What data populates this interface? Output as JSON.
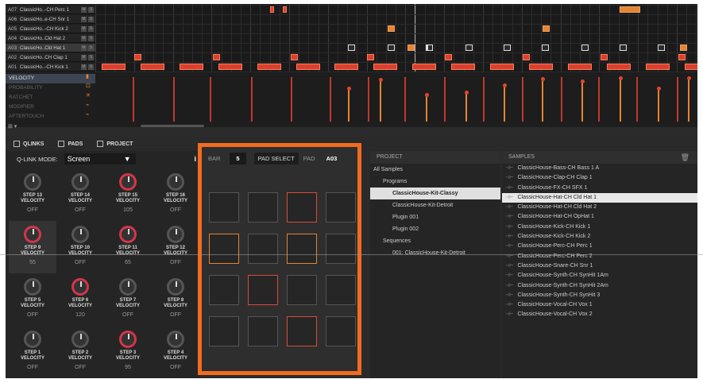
{
  "tracks": [
    {
      "num": "A07",
      "name": "ClassicHo..-CH Perc 1"
    },
    {
      "num": "A06",
      "name": "ClassicHo..e-CH Snr 1"
    },
    {
      "num": "A05",
      "name": "ClassicHo..-CH Kick 2"
    },
    {
      "num": "A04",
      "name": "ClassicHo..Cld Hat 2"
    },
    {
      "num": "A03",
      "name": "ClassicHo..Cld Hat 1"
    },
    {
      "num": "A02",
      "name": "ClassicHo..CH Clap 1"
    },
    {
      "num": "A01",
      "name": "ClassicHo..-CH Kick 1"
    }
  ],
  "track_buttons": {
    "mute": "M",
    "solo": "S"
  },
  "params": [
    "VELOCITY",
    "PROBABILITY",
    "RATCHET",
    "MODIFIER",
    "AFTERTOUCH"
  ],
  "tabs": {
    "qlinks": "QLINKS",
    "pads": "PADS",
    "project": "PROJECT"
  },
  "qlink": {
    "mode_label": "Q-LINK MODE:",
    "mode_value": "Screen",
    "info": "i"
  },
  "knobs": [
    {
      "step": "STEP 13",
      "param": "VELOCITY",
      "value": "OFF",
      "active": false
    },
    {
      "step": "STEP 14",
      "param": "VELOCITY",
      "value": "OFF",
      "active": false
    },
    {
      "step": "STEP 15",
      "param": "VELOCITY",
      "value": "105",
      "active": true
    },
    {
      "step": "STEP 16",
      "param": "VELOCITY",
      "value": "OFF",
      "active": false
    },
    {
      "step": "STEP 9",
      "param": "VELOCITY",
      "value": "55",
      "active": true
    },
    {
      "step": "STEP 10",
      "param": "VELOCITY",
      "value": "OFF",
      "active": false
    },
    {
      "step": "STEP 11",
      "param": "VELOCITY",
      "value": "65",
      "active": true
    },
    {
      "step": "STEP 12",
      "param": "VELOCITY",
      "value": "OFF",
      "active": false
    },
    {
      "step": "STEP 5",
      "param": "VELOCITY",
      "value": "OFF",
      "active": false
    },
    {
      "step": "STEP 6",
      "param": "VELOCITY",
      "value": "120",
      "active": true
    },
    {
      "step": "STEP 7",
      "param": "VELOCITY",
      "value": "OFF",
      "active": false
    },
    {
      "step": "STEP 8",
      "param": "VELOCITY",
      "value": "OFF",
      "active": false
    },
    {
      "step": "STEP 1",
      "param": "VELOCITY",
      "value": "OFF",
      "active": false
    },
    {
      "step": "STEP 2",
      "param": "VELOCITY",
      "value": "OFF",
      "active": false
    },
    {
      "step": "STEP 3",
      "param": "VELOCITY",
      "value": "95",
      "active": true
    },
    {
      "step": "STEP 4",
      "param": "VELOCITY",
      "value": "OFF",
      "active": false
    }
  ],
  "pads": {
    "bar_label": "BAR",
    "bar_value": "5",
    "pad_select": "PAD SELECT",
    "pad_label": "PAD",
    "pad_value": "A03",
    "pad_states": [
      "n",
      "n",
      "r",
      "n",
      "o",
      "n",
      "o",
      "n",
      "n",
      "r",
      "n",
      "n",
      "n",
      "n",
      "r",
      "n"
    ]
  },
  "project": {
    "header": "PROJECT",
    "items": [
      {
        "label": "All Samples",
        "indent": 0,
        "selected": false
      },
      {
        "label": "Programs",
        "indent": 1,
        "selected": false
      },
      {
        "label": "ClassicHouse-Kit-Classy",
        "indent": 2,
        "selected": true
      },
      {
        "label": "ClassicHouse-Kit-Detroit",
        "indent": 2,
        "selected": false
      },
      {
        "label": "Plugin 001",
        "indent": 2,
        "selected": false
      },
      {
        "label": "Plugin 002",
        "indent": 2,
        "selected": false
      },
      {
        "label": "Sequences",
        "indent": 1,
        "selected": false
      },
      {
        "label": "001: ClassicHouse-Kit-Detroit",
        "indent": 2,
        "selected": false
      }
    ]
  },
  "samples": {
    "header": "SAMPLES",
    "items": [
      "ClassicHouse-Bass-CH Bass 1 A",
      "ClassicHouse-Clap-CH Clap 1",
      "ClassicHouse-FX-CH SFX 1",
      "ClassicHouse-Hat-CH Cld Hat 1",
      "ClassicHouse-Hat-CH Cld Hat 2",
      "ClassicHouse-Hat-CH OpHat 1",
      "ClassicHouse-Kick-CH Kick 1",
      "ClassicHouse-Kick-CH Kick 2",
      "ClassicHouse-Perc-CH Perc 1",
      "ClassicHouse-Perc-CH Perc 2",
      "ClassicHouse-Snare-CH Snr 1",
      "ClassicHouse-Synth-CH SynHit 1Am",
      "ClassicHouse-Synth-CH SynHit 2Am",
      "ClassicHouse-Synth-CH SynHit 3",
      "ClassicHouse-Vocal-CH Vox 1",
      "ClassicHouse-Vocal-CH Vox 2"
    ],
    "selected_index": 3
  },
  "colors": {
    "accent": "#f26c1f",
    "note": "#d9412f",
    "orange_note": "#e58432"
  }
}
